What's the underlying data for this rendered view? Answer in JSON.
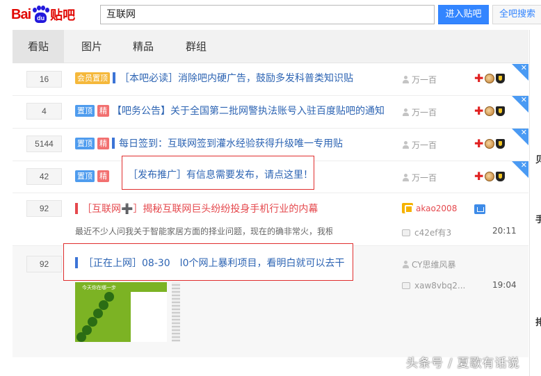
{
  "header": {
    "logo_bai": "Bai",
    "logo_du": "du",
    "logo_tieba": "贴吧",
    "search_value": "互联网",
    "enter_button": "进入贴吧",
    "all_search_button": "全吧搜索"
  },
  "tabs": [
    "看贴",
    "图片",
    "精品",
    "群组"
  ],
  "threads": [
    {
      "count": "16",
      "badges": [
        "会员置顶"
      ],
      "title": "［本吧必读］消除吧内硬广告，鼓励多发科普类知识贴",
      "author": "万一百"
    },
    {
      "count": "4",
      "badges": [
        "置顶",
        "精"
      ],
      "title": "【吧务公告】关于全国第二批网警执法账号入驻百度贴吧的通知",
      "author": "万一百"
    },
    {
      "count": "5144",
      "badges": [
        "置顶",
        "精"
      ],
      "title": "每日签到：互联网签到灌水经验获得升级唯一专用贴",
      "author": "万一百"
    },
    {
      "count": "42",
      "badges": [
        "置顶",
        "精"
      ],
      "title": "［发布推广］有信息需要发布，请点这里！",
      "author": "万一百"
    },
    {
      "count": "92",
      "title": "［互联网➕］揭秘互联网巨头纷纷投身手机行业的内幕",
      "abstract": "最近不少人问我关于智能家居方面的择业问题，现在的确非常火，我根据什么朋友的",
      "author": "akao2008",
      "last_reply": "c42ef有3",
      "time": "20:11"
    },
    {
      "count": "92",
      "title": "［正在上网］08-30　l0个网上暴利项目，看明白就可以去干",
      "author": "CY思维风暴",
      "last_reply": "xaw8vbq2...",
      "time": "19:04",
      "thumb_text": "今天你在哪一步"
    }
  ],
  "corner_close": "✕",
  "right_pane": [
    "贝",
    "手",
    "排"
  ],
  "watermark": "头条号 / 夏歌有话说",
  "colors": {
    "accent": "#3385ff",
    "link": "#2d64b3",
    "highlight_border": "#e02d2d",
    "brand_red": "#e10601"
  }
}
